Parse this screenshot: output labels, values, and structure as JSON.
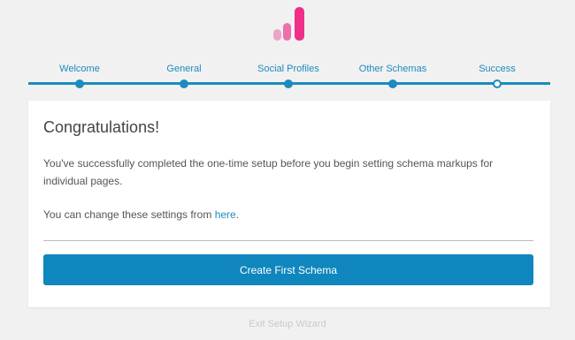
{
  "colors": {
    "accent": "#1b8bbf",
    "button": "#0f86bd",
    "logo": [
      "#e9a6c8",
      "#ec6fae",
      "#ef2f88"
    ],
    "background": "#f1f1f1"
  },
  "logo": {
    "icon": "bar-chart-logo"
  },
  "wizard": {
    "steps": [
      {
        "label": "Welcome",
        "state": "done"
      },
      {
        "label": "General",
        "state": "done"
      },
      {
        "label": "Social Profiles",
        "state": "done"
      },
      {
        "label": "Other Schemas",
        "state": "done"
      },
      {
        "label": "Success",
        "state": "current"
      }
    ]
  },
  "card": {
    "title": "Congratulations!",
    "message": "You've successfully completed the one-time setup before you begin setting schema markups for individual pages.",
    "settings_text": "You can change these settings from ",
    "settings_link": "here",
    "settings_suffix": ".",
    "cta_label": "Create First Schema"
  },
  "footer": {
    "exit_label": "Exit Setup Wizard"
  }
}
